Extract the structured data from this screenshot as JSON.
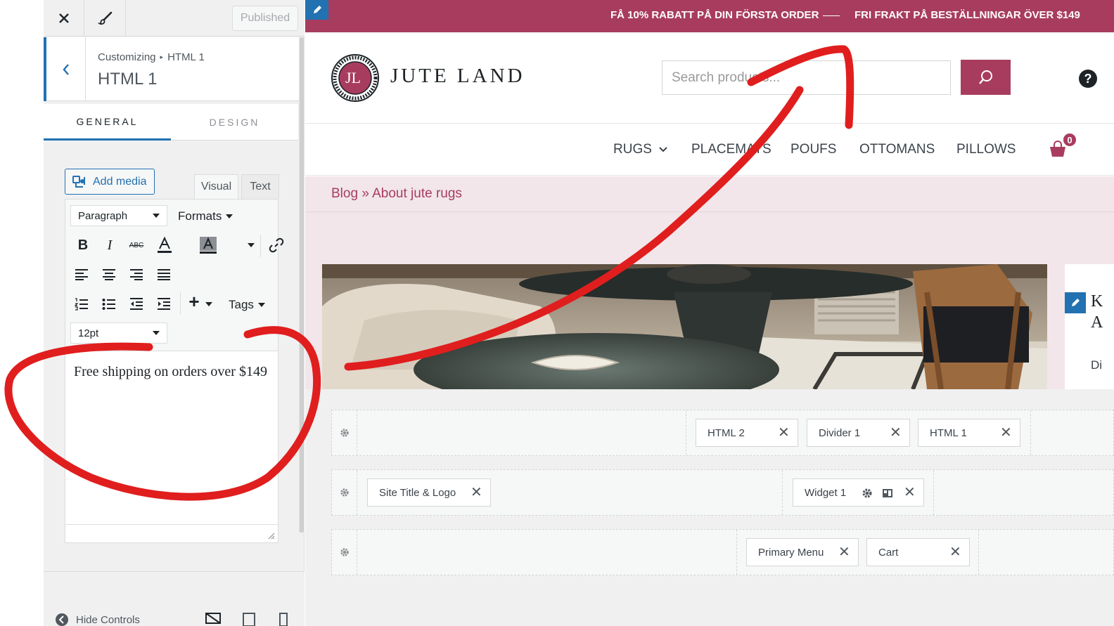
{
  "customizer": {
    "close_label": "✕",
    "published_label": "Published",
    "breadcrumb": {
      "root": "Customizing",
      "separator": "▸",
      "current": "HTML 1"
    },
    "section_title": "HTML 1",
    "tabs": [
      {
        "label": "GENERAL",
        "active": true
      },
      {
        "label": "DESIGN",
        "active": false
      }
    ],
    "editor": {
      "add_media_label": "Add media",
      "mode_tabs": [
        "Visual",
        "Text"
      ],
      "block_format": "Paragraph",
      "formats_label": "Formats",
      "tags_label": "Tags",
      "font_size": "12pt",
      "content": "Free shipping on orders over $149"
    },
    "footer": {
      "hide_controls_label": "Hide Controls"
    }
  },
  "preview": {
    "promo": {
      "message_1": "FÅ 10% RABATT PÅ DIN FÖRSTA ORDER",
      "message_2": "FRI FRAKT PÅ BESTÄLLNINGAR ÖVER $149"
    },
    "logo_initials": "JL",
    "site_title": "JUTE LAND",
    "search_placeholder": "Search products...",
    "help_label": "?",
    "nav": {
      "items": [
        "RUGS",
        "PLACEMATS",
        "POUFS",
        "OTTOMANS",
        "PILLOWS"
      ],
      "cart_count": "0"
    },
    "breadcrumb": {
      "blog": "Blog",
      "separator": "»",
      "current": "About jute rugs"
    },
    "sidebar_letters": [
      "K",
      "A",
      "Di"
    ],
    "builder": {
      "row1": [
        "HTML 2",
        "Divider 1",
        "HTML 1"
      ],
      "row2": [
        "Site Title & Logo",
        "Widget 1"
      ],
      "row3": [
        "Primary Menu",
        "Cart"
      ]
    }
  },
  "colors": {
    "accent": "#a83c5f",
    "wp_blue": "#2271b1",
    "annotation_red": "#e01e1e"
  }
}
